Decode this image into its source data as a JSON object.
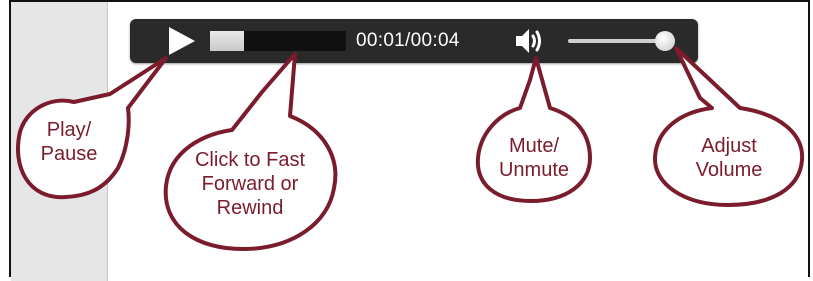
{
  "player": {
    "time_display": "00:01/00:04",
    "progress_fraction": 0.25,
    "volume_fraction": 0.9,
    "play_icon": "play-icon",
    "volume_icon": "speaker-icon",
    "bar_color": "#2a2a2a"
  },
  "callouts": {
    "play_pause": [
      "Play/",
      "Pause"
    ],
    "seek": [
      "Click to Fast",
      "Forward or",
      "Rewind"
    ],
    "mute": [
      "Mute/",
      "Unmute"
    ],
    "volume": [
      "Adjust",
      "Volume"
    ],
    "border_color": "#7a1c2c"
  }
}
